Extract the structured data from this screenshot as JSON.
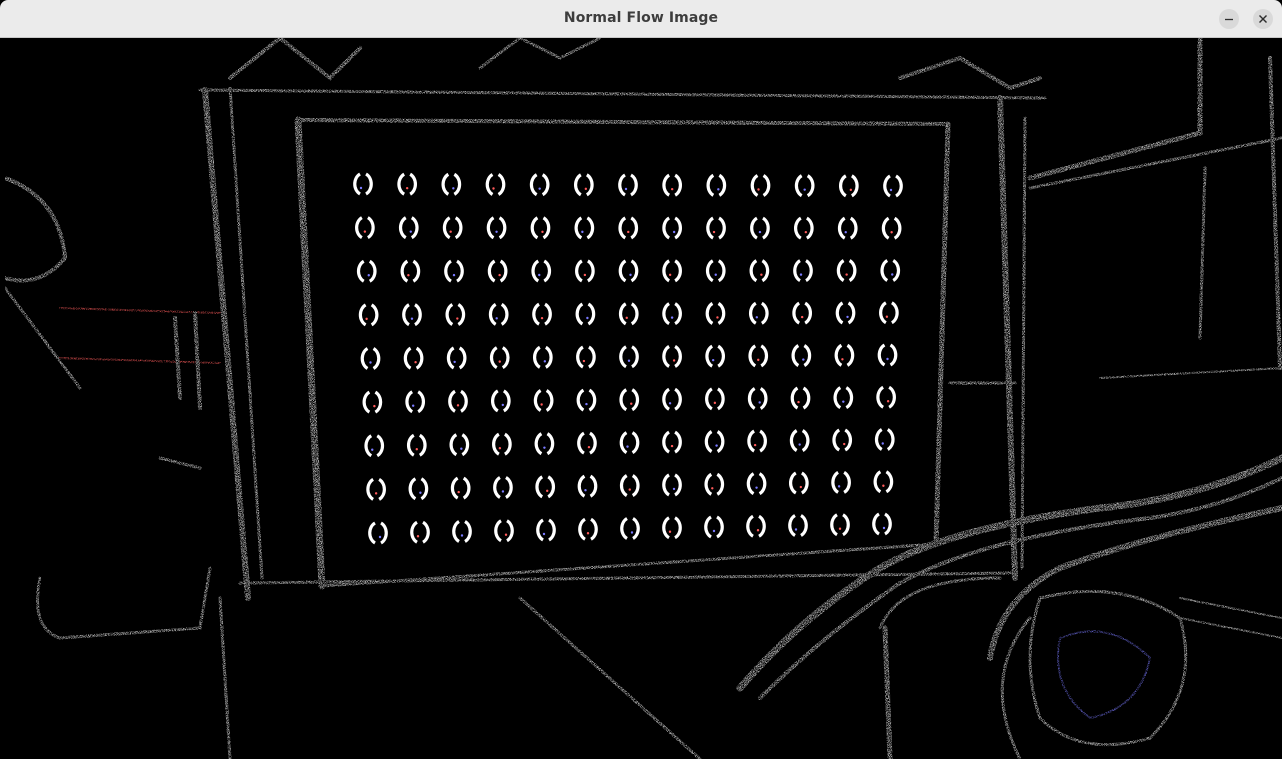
{
  "window": {
    "title": "Normal Flow Image",
    "buttons": {
      "minimize_icon": "minimize-icon",
      "close_icon": "close-icon"
    }
  },
  "image": {
    "description_icon": "normal-flow-visualization",
    "colors": {
      "background": "#000000",
      "edge": "#ffffff",
      "tint_red": "#ff5a5a",
      "tint_blue": "#7a7aff"
    },
    "calibration_grid": {
      "rows": 9,
      "cols": 13
    }
  }
}
